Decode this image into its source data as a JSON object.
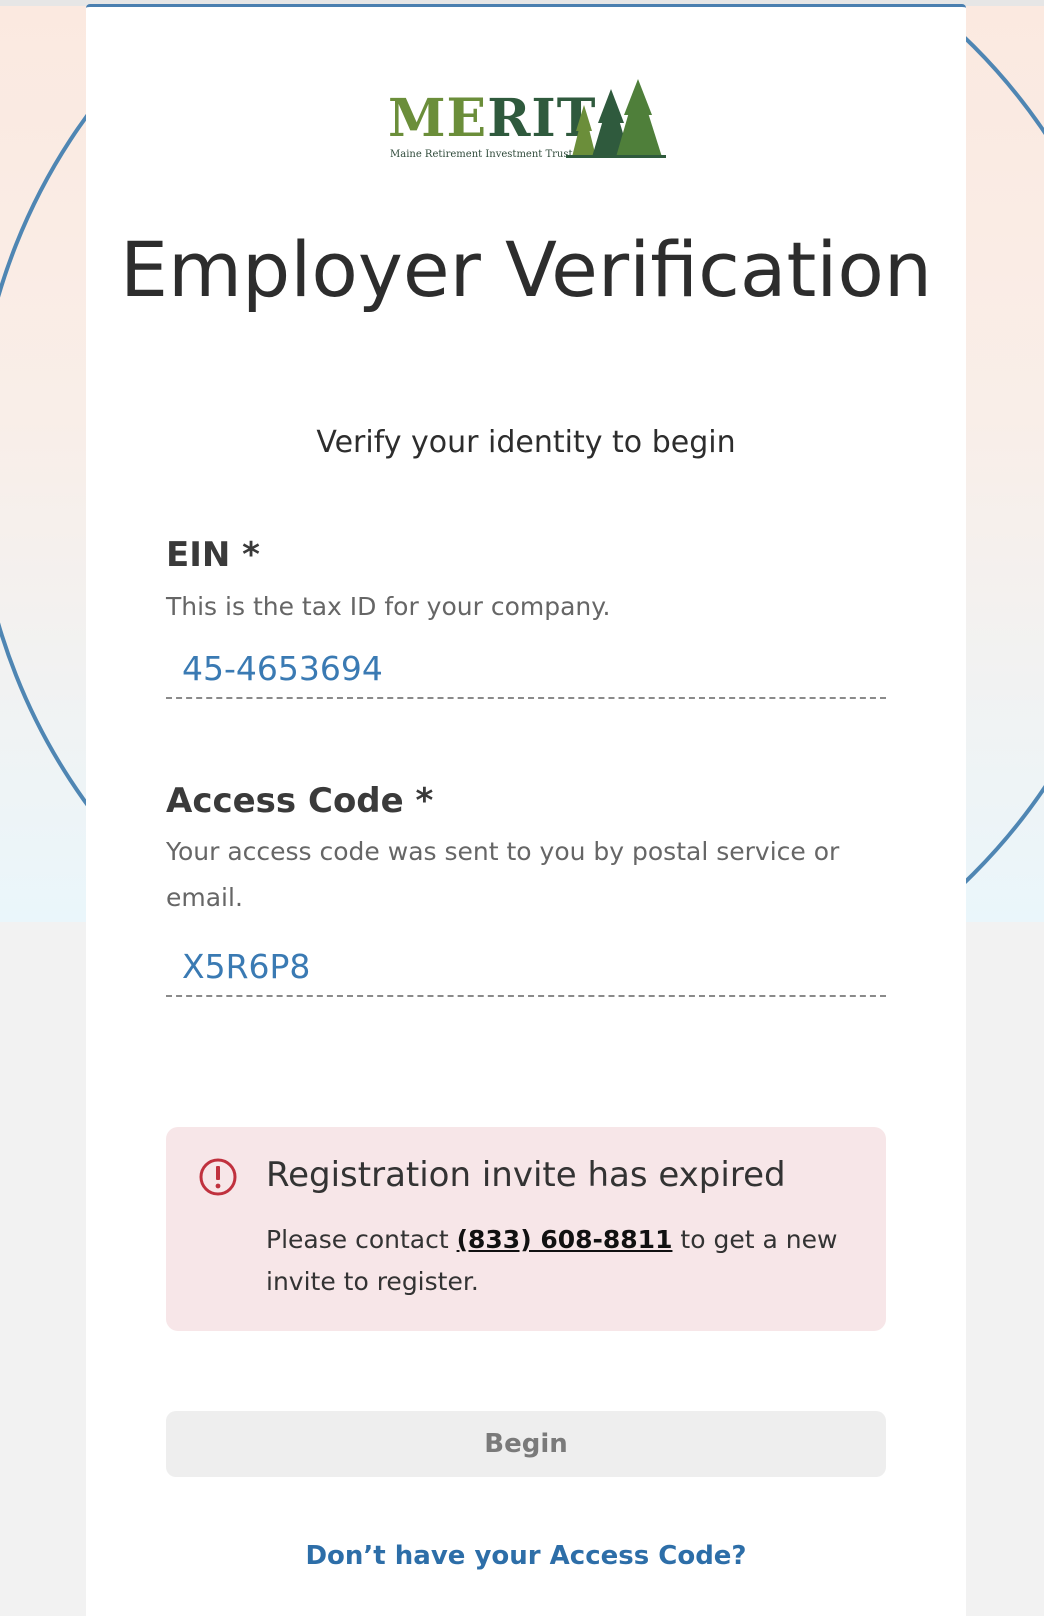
{
  "brand": {
    "logo_word_part1": "ME",
    "logo_word_part2": "RIT",
    "logo_tagline": "Maine Retirement Investment Trust",
    "colors": {
      "primary_green": "#6b8e3a",
      "dark_green": "#2f5a3d",
      "accent_blue": "#3a7ab3"
    }
  },
  "page": {
    "title": "Employer Verification",
    "subtitle": "Verify your identity to begin"
  },
  "form": {
    "ein": {
      "label": "EIN *",
      "help": "This is the tax ID for your company.",
      "value": "45-4653694"
    },
    "access_code": {
      "label": "Access Code *",
      "help": "Your access code was sent to you by postal service or email.",
      "value": "X5R6P8"
    }
  },
  "alert": {
    "icon": "alert-circle-icon",
    "title": "Registration invite has expired",
    "body_prefix": "Please contact ",
    "phone": "(833) 608-8811",
    "body_suffix": " to get a new invite to register."
  },
  "actions": {
    "begin_label": "Begin",
    "access_code_link": "Don’t have your Access Code?"
  }
}
